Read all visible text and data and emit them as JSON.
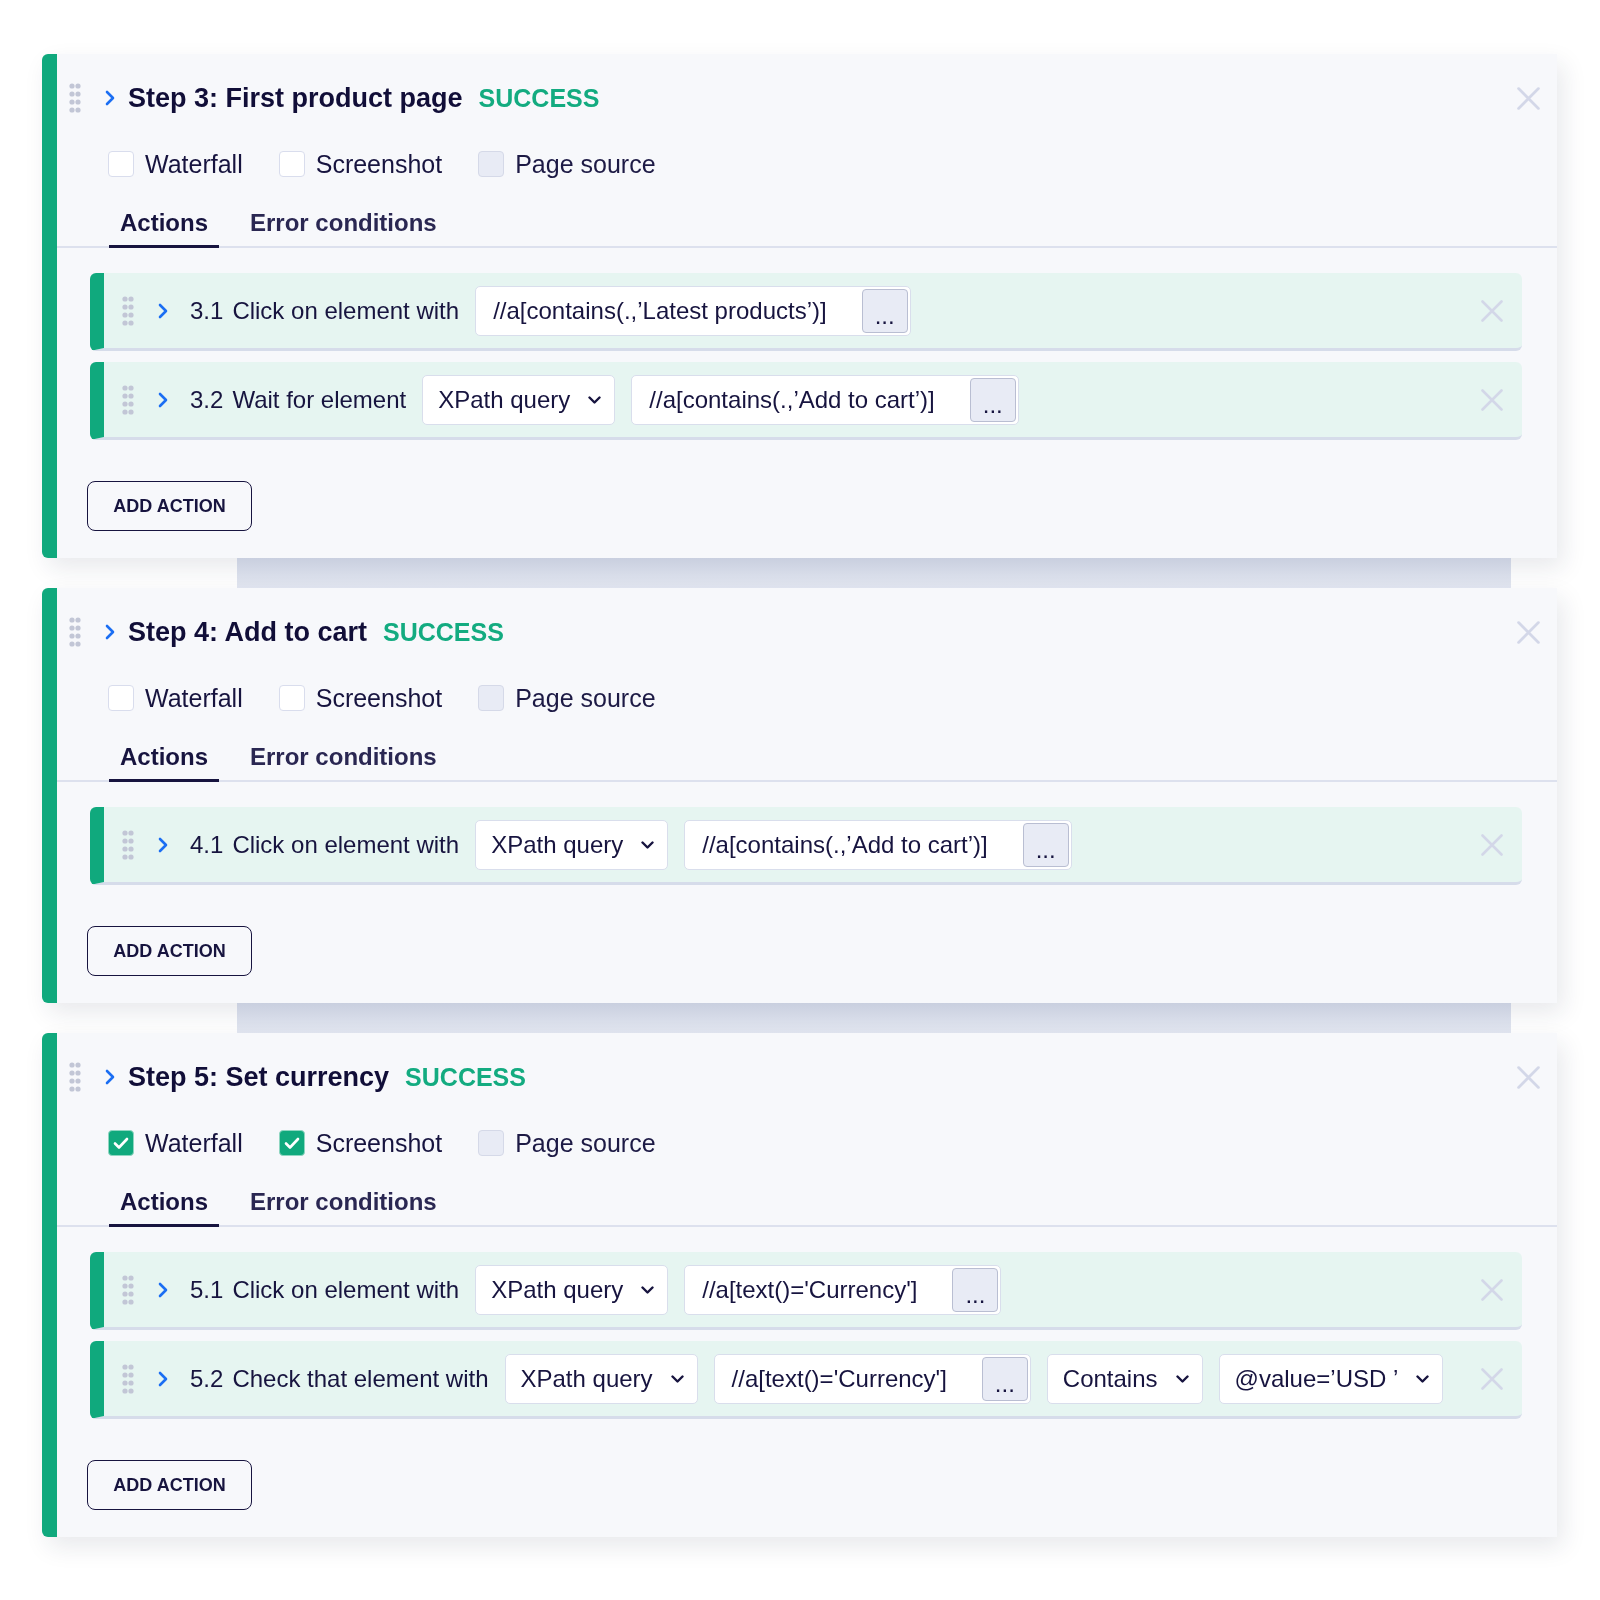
{
  "steps": [
    {
      "title": "Step 3: First product page",
      "status": "SUCCESS",
      "options": [
        {
          "label": "Waterfall",
          "checked": false,
          "disabled": false
        },
        {
          "label": "Screenshot",
          "checked": false,
          "disabled": false
        },
        {
          "label": "Page source",
          "checked": false,
          "disabled": true
        }
      ],
      "tabs": [
        {
          "label": "Actions",
          "selected": true
        },
        {
          "label": "Error conditions",
          "selected": false
        }
      ],
      "actions": [
        {
          "number": "3.1",
          "label": "Click on element with",
          "fields": [
            {
              "kind": "input",
              "value": "//a[contains(.,’Latest products’)]",
              "button": "..."
            }
          ]
        },
        {
          "number": "3.2",
          "label": "Wait for element",
          "fields": [
            {
              "kind": "select",
              "value": "XPath query"
            },
            {
              "kind": "input",
              "value": "//a[contains(.,’Add to cart’)]",
              "button": "..."
            }
          ]
        }
      ],
      "add_button": "ADD ACTION"
    },
    {
      "title": "Step 4: Add to cart",
      "status": "SUCCESS",
      "options": [
        {
          "label": "Waterfall",
          "checked": false,
          "disabled": false
        },
        {
          "label": "Screenshot",
          "checked": false,
          "disabled": false
        },
        {
          "label": "Page source",
          "checked": false,
          "disabled": true
        }
      ],
      "tabs": [
        {
          "label": "Actions",
          "selected": true
        },
        {
          "label": "Error conditions",
          "selected": false
        }
      ],
      "actions": [
        {
          "number": "4.1",
          "label": "Click on element with",
          "fields": [
            {
              "kind": "select",
              "value": "XPath query"
            },
            {
              "kind": "input",
              "value": "//a[contains(.,’Add to cart’)]",
              "button": "..."
            }
          ]
        }
      ],
      "add_button": "ADD ACTION"
    },
    {
      "title": "Step 5: Set currency",
      "status": "SUCCESS",
      "options": [
        {
          "label": "Waterfall",
          "checked": true,
          "disabled": false
        },
        {
          "label": "Screenshot",
          "checked": true,
          "disabled": false
        },
        {
          "label": "Page source",
          "checked": false,
          "disabled": true
        }
      ],
      "tabs": [
        {
          "label": "Actions",
          "selected": true
        },
        {
          "label": "Error conditions",
          "selected": false
        }
      ],
      "actions": [
        {
          "number": "5.1",
          "label": "Click on element with",
          "fields": [
            {
              "kind": "select",
              "value": "XPath query"
            },
            {
              "kind": "input",
              "value": "//a[text()='Currency']",
              "button": "..."
            }
          ]
        },
        {
          "number": "5.2",
          "label": "Check that element with",
          "fields": [
            {
              "kind": "select",
              "value": "XPath query"
            },
            {
              "kind": "input",
              "value": "//a[text()='Currency']",
              "button": "..."
            },
            {
              "kind": "select",
              "value": "Contains"
            },
            {
              "kind": "select",
              "value": "@value=’USD ’"
            }
          ]
        }
      ],
      "add_button": "ADD ACTION"
    }
  ]
}
